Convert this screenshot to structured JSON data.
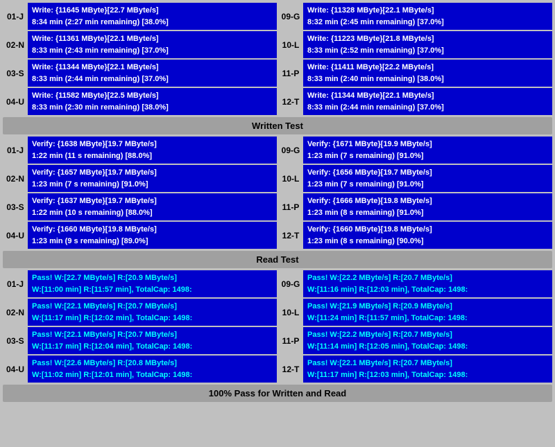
{
  "sections": {
    "write_test": {
      "label": "Written Test",
      "left_cells": [
        {
          "id": "01-J",
          "line1": "Write: {11645 MByte}[22.7 MByte/s]",
          "line2": "8:34 min (2:27 min remaining)  [38.0%]"
        },
        {
          "id": "02-N",
          "line1": "Write: {11361 MByte}[22.1 MByte/s]",
          "line2": "8:33 min (2:43 min remaining)  [37.0%]"
        },
        {
          "id": "03-S",
          "line1": "Write: {11344 MByte}[22.1 MByte/s]",
          "line2": "8:33 min (2:44 min remaining)  [37.0%]"
        },
        {
          "id": "04-U",
          "line1": "Write: {11582 MByte}[22.5 MByte/s]",
          "line2": "8:33 min (2:30 min remaining)  [38.0%]"
        }
      ],
      "right_cells": [
        {
          "id": "09-G",
          "line1": "Write: {11328 MByte}[22.1 MByte/s]",
          "line2": "8:32 min (2:45 min remaining)  [37.0%]"
        },
        {
          "id": "10-L",
          "line1": "Write: {11223 MByte}[21.8 MByte/s]",
          "line2": "8:33 min (2:52 min remaining)  [37.0%]"
        },
        {
          "id": "11-P",
          "line1": "Write: {11411 MByte}[22.2 MByte/s]",
          "line2": "8:33 min (2:40 min remaining)  [38.0%]"
        },
        {
          "id": "12-T",
          "line1": "Write: {11344 MByte}[22.1 MByte/s]",
          "line2": "8:33 min (2:44 min remaining)  [37.0%]"
        }
      ]
    },
    "verify_test": {
      "left_cells": [
        {
          "id": "01-J",
          "line1": "Verify: {1638 MByte}[19.7 MByte/s]",
          "line2": "1:22 min (11 s remaining)   [88.0%]"
        },
        {
          "id": "02-N",
          "line1": "Verify: {1657 MByte}[19.7 MByte/s]",
          "line2": "1:23 min (7 s remaining)   [91.0%]"
        },
        {
          "id": "03-S",
          "line1": "Verify: {1637 MByte}[19.7 MByte/s]",
          "line2": "1:22 min (10 s remaining)   [88.0%]"
        },
        {
          "id": "04-U",
          "line1": "Verify: {1660 MByte}[19.8 MByte/s]",
          "line2": "1:23 min (9 s remaining)   [89.0%]"
        }
      ],
      "right_cells": [
        {
          "id": "09-G",
          "line1": "Verify: {1671 MByte}[19.9 MByte/s]",
          "line2": "1:23 min (7 s remaining)   [91.0%]"
        },
        {
          "id": "10-L",
          "line1": "Verify: {1656 MByte}[19.7 MByte/s]",
          "line2": "1:23 min (7 s remaining)   [91.0%]"
        },
        {
          "id": "11-P",
          "line1": "Verify: {1666 MByte}[19.8 MByte/s]",
          "line2": "1:23 min (8 s remaining)   [91.0%]"
        },
        {
          "id": "12-T",
          "line1": "Verify: {1660 MByte}[19.8 MByte/s]",
          "line2": "1:23 min (8 s remaining)   [90.0%]"
        }
      ]
    },
    "read_test": {
      "label": "Read Test",
      "left_cells": [
        {
          "id": "01-J",
          "line1": "Pass! W:[22.7 MByte/s] R:[20.9 MByte/s]",
          "line2": "W:[11:00 min] R:[11:57 min], TotalCap: 1498:"
        },
        {
          "id": "02-N",
          "line1": "Pass! W:[22.1 MByte/s] R:[20.7 MByte/s]",
          "line2": "W:[11:17 min] R:[12:02 min], TotalCap: 1498:"
        },
        {
          "id": "03-S",
          "line1": "Pass! W:[22.1 MByte/s] R:[20.7 MByte/s]",
          "line2": "W:[11:17 min] R:[12:04 min], TotalCap: 1498:"
        },
        {
          "id": "04-U",
          "line1": "Pass! W:[22.6 MByte/s] R:[20.8 MByte/s]",
          "line2": "W:[11:02 min] R:[12:01 min], TotalCap: 1498:"
        }
      ],
      "right_cells": [
        {
          "id": "09-G",
          "line1": "Pass! W:[22.2 MByte/s] R:[20.7 MByte/s]",
          "line2": "W:[11:16 min] R:[12:03 min], TotalCap: 1498:"
        },
        {
          "id": "10-L",
          "line1": "Pass! W:[21.9 MByte/s] R:[20.9 MByte/s]",
          "line2": "W:[11:24 min] R:[11:57 min], TotalCap: 1498:"
        },
        {
          "id": "11-P",
          "line1": "Pass! W:[22.2 MByte/s] R:[20.7 MByte/s]",
          "line2": "W:[11:14 min] R:[12:05 min], TotalCap: 1498:"
        },
        {
          "id": "12-T",
          "line1": "Pass! W:[22.1 MByte/s] R:[20.7 MByte/s]",
          "line2": "W:[11:17 min] R:[12:03 min], TotalCap: 1498:"
        }
      ]
    }
  },
  "headers": {
    "written_test": "Written Test",
    "read_test": "Read Test"
  },
  "footer": "100% Pass for Written and Read"
}
